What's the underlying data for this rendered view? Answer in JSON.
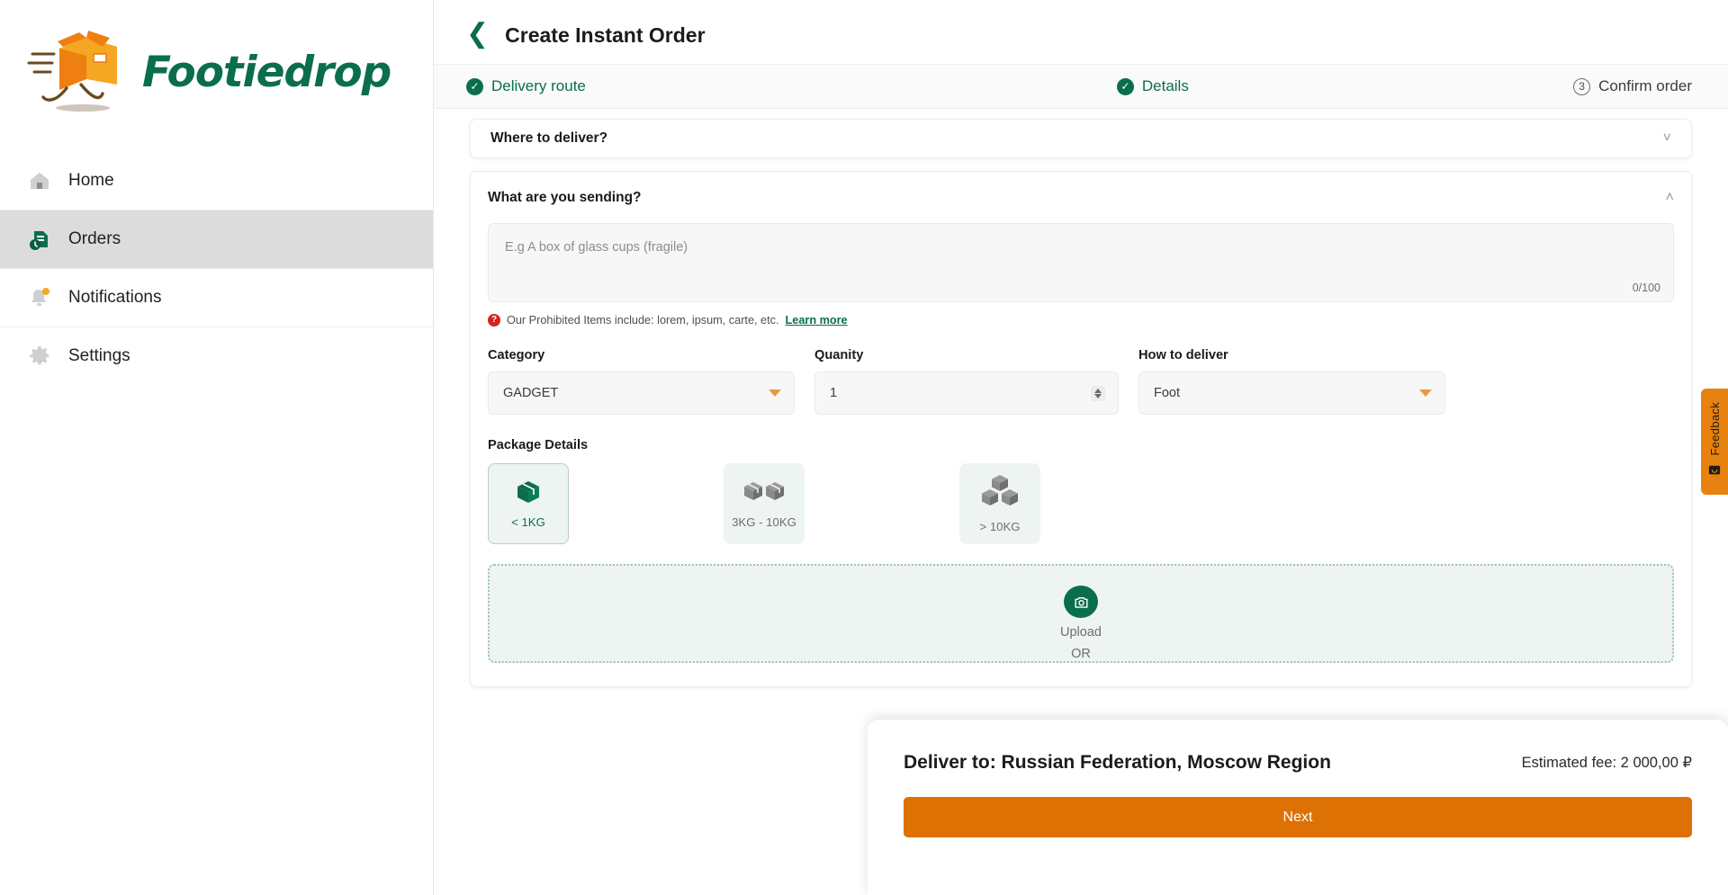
{
  "brand": {
    "name": "Footiedrop",
    "primary_color": "#0a6e4d",
    "accent_color": "#e8820e"
  },
  "sidebar": {
    "items": [
      {
        "label": "Home",
        "icon": "home-icon",
        "active": false
      },
      {
        "label": "Orders",
        "icon": "orders-icon",
        "active": true
      },
      {
        "label": "Notifications",
        "icon": "bell-icon",
        "active": false,
        "badge": true
      },
      {
        "label": "Settings",
        "icon": "gear-icon",
        "active": false
      }
    ]
  },
  "header": {
    "title": "Create Instant Order",
    "back_icon": "chevron-left-icon"
  },
  "stepper": {
    "steps": [
      {
        "label": "Delivery route",
        "state": "done",
        "icon": "check-circle-icon"
      },
      {
        "label": "Details",
        "state": "done",
        "icon": "check-circle-icon"
      },
      {
        "label": "Confirm order",
        "state": "todo",
        "number": "3"
      }
    ]
  },
  "sections": {
    "where_to_deliver": {
      "title": "Where to deliver?",
      "collapsed": true,
      "chevron": "chevron-down-icon"
    },
    "what_sending": {
      "title": "What are you sending?",
      "collapsed": false,
      "chevron": "chevron-up-icon",
      "description_placeholder": "E.g A box of glass cups (fragile)",
      "description_value": "",
      "char_counter": "0/100",
      "prohibited_notice": "Our Prohibited Items include: lorem, ipsum, carte, etc.",
      "learn_more_label": "Learn more"
    }
  },
  "form": {
    "category": {
      "label": "Category",
      "value": "GADGET",
      "icon": "triangle-down-icon"
    },
    "quantity": {
      "label": "Quanity",
      "value": "1",
      "icon": "spinner-icon"
    },
    "how_to_deliver": {
      "label": "How to deliver",
      "value": "Foot",
      "icon": "chevron-down-icon"
    }
  },
  "package_details": {
    "label": "Package Details",
    "options": [
      {
        "label": "< 1KG",
        "icon": "single-box-icon",
        "selected": true
      },
      {
        "label": "3KG - 10KG",
        "icon": "double-box-icon",
        "selected": false
      },
      {
        "label": "> 10KG",
        "icon": "triple-box-icon",
        "selected": false
      }
    ]
  },
  "upload": {
    "icon": "camera-icon",
    "label": "Upload",
    "or_label": "OR"
  },
  "bottom_bar": {
    "deliver_to": "Deliver to: Russian Federation, Moscow Region",
    "estimated_fee": "Estimated fee: 2 000,00 ₽",
    "next_label": "Next"
  },
  "feedback": {
    "label": "Feedback",
    "icon": "feedback-icon"
  }
}
